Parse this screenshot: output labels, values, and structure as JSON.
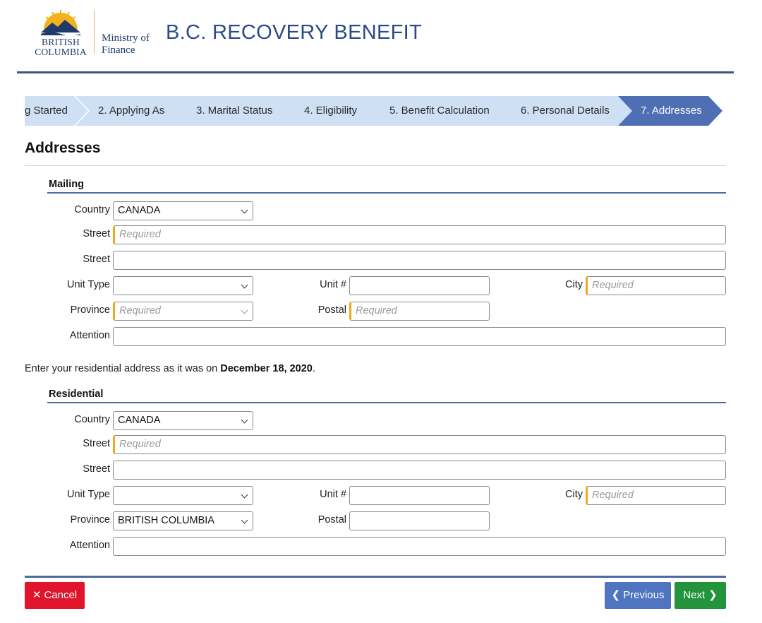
{
  "header": {
    "logo_line1": "BRITISH",
    "logo_line2": "COLUMBIA",
    "ministry_line1": "Ministry of",
    "ministry_line2": "Finance",
    "app_title": "B.C. RECOVERY BENEFIT"
  },
  "steps": [
    {
      "label": "g Started"
    },
    {
      "label": "2. Applying As"
    },
    {
      "label": "3. Marital Status"
    },
    {
      "label": "4. Eligibility"
    },
    {
      "label": "5. Benefit Calculation"
    },
    {
      "label": "6. Personal Details"
    },
    {
      "label": "7. Addresses"
    }
  ],
  "page_title": "Addresses",
  "mailing": {
    "section_title": "Mailing",
    "labels": {
      "country": "Country",
      "street1": "Street",
      "street2": "Street",
      "unit_type": "Unit Type",
      "unit_num": "Unit #",
      "city": "City",
      "province": "Province",
      "postal": "Postal",
      "attention": "Attention"
    },
    "country_value": "CANADA",
    "street1_placeholder": "Required",
    "city_placeholder": "Required",
    "province_placeholder": "Required",
    "postal_placeholder": "Required"
  },
  "note": {
    "prefix": "Enter your residential address as it was on ",
    "date": "December 18, 2020",
    "suffix": "."
  },
  "residential": {
    "section_title": "Residential",
    "labels": {
      "country": "Country",
      "street1": "Street",
      "street2": "Street",
      "unit_type": "Unit Type",
      "unit_num": "Unit #",
      "city": "City",
      "province": "Province",
      "postal": "Postal",
      "attention": "Attention"
    },
    "country_value": "CANADA",
    "street1_placeholder": "Required",
    "city_placeholder": "Required",
    "province_value": "BRITISH COLUMBIA"
  },
  "buttons": {
    "cancel": "Cancel",
    "previous": "Previous",
    "next": "Next"
  },
  "colors": {
    "accent_blue": "#4e6fb3",
    "step_inactive": "#cfe0f5",
    "required_marker": "#f2a81d",
    "cancel_red": "#e0142b",
    "next_green": "#23943c"
  }
}
